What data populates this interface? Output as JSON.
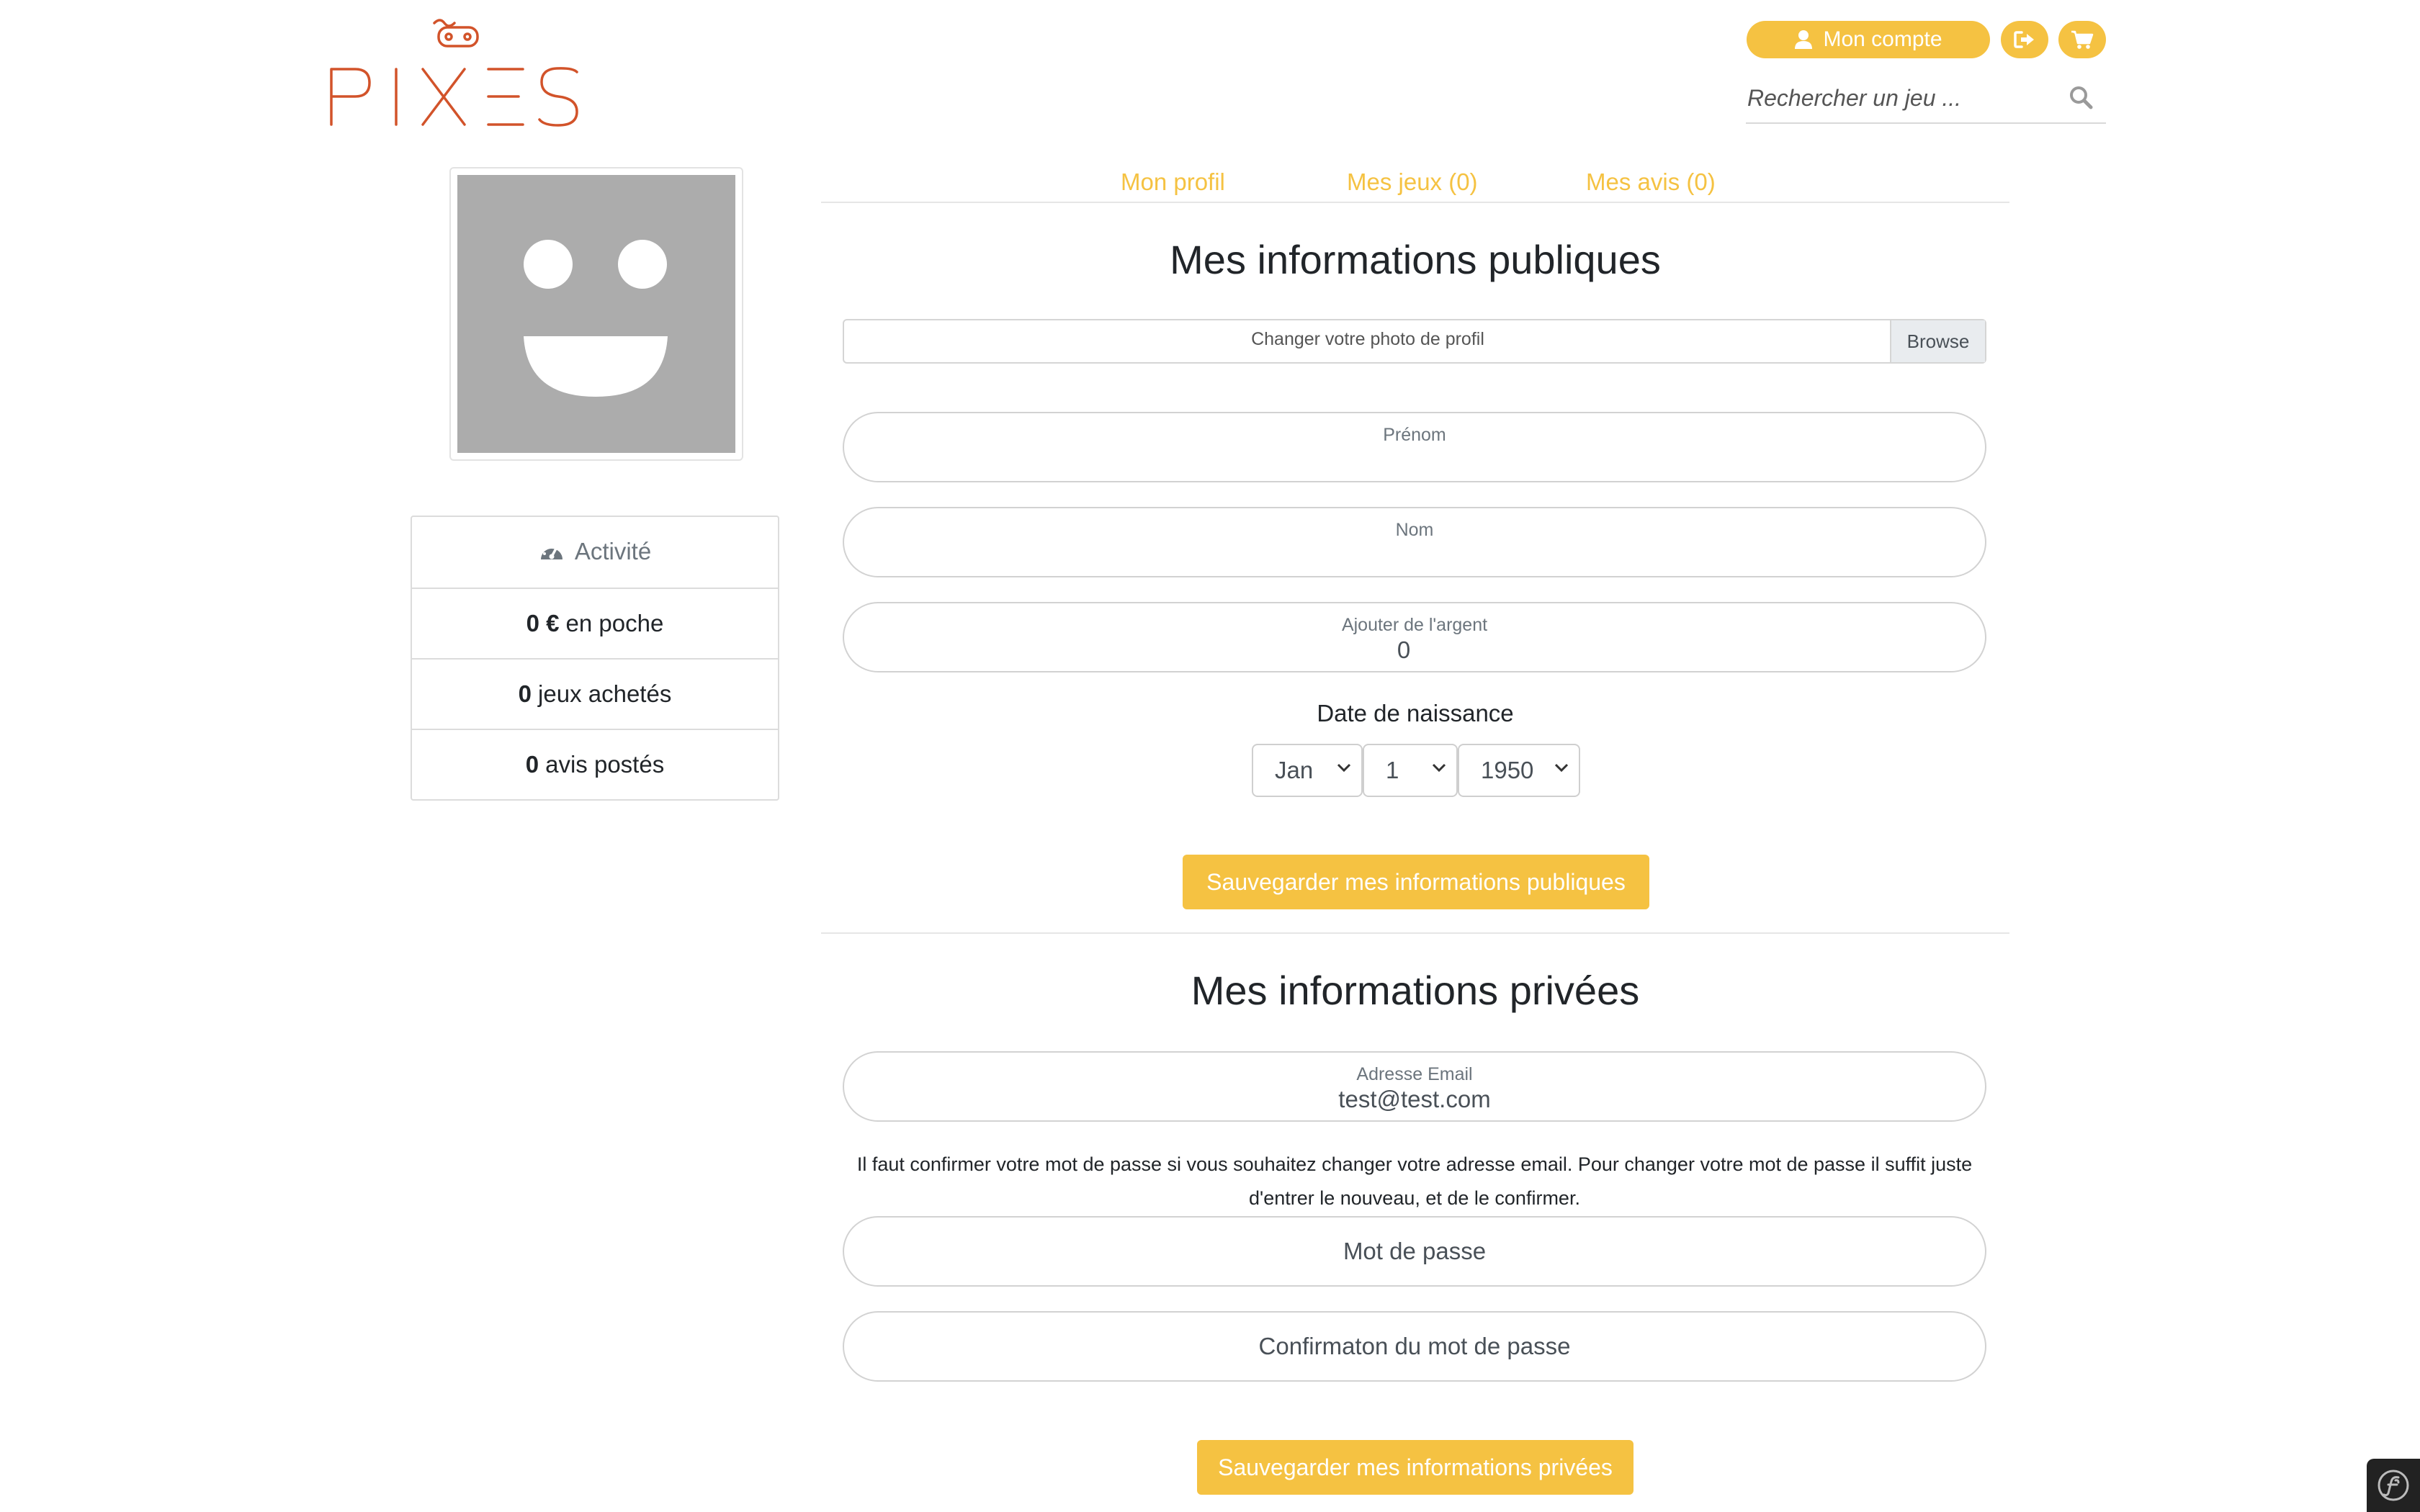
{
  "brand": {
    "logo_text": "PIXES",
    "accent_color": "#f5c242",
    "logo_color": "#d2532a"
  },
  "header": {
    "account_label": "Mon compte",
    "account_icon": "user-icon",
    "logout_icon": "sign-out-icon",
    "cart_icon": "shopping-cart-icon",
    "search_placeholder": "Rechercher un jeu ...",
    "search_icon": "search-icon"
  },
  "sidebar": {
    "avatar_icon": "smiley-avatar-icon",
    "activity": {
      "title": "Activité",
      "title_icon": "tachometer-icon",
      "rows": [
        {
          "value": "0 €",
          "label": "en poche"
        },
        {
          "value": "0",
          "label": "jeux achetés"
        },
        {
          "value": "0",
          "label": "avis postés"
        }
      ]
    }
  },
  "tabs": [
    {
      "label": "Mon profil"
    },
    {
      "label": "Mes jeux (0)"
    },
    {
      "label": "Mes avis (0)"
    }
  ],
  "public_section": {
    "title": "Mes informations publiques",
    "photo_label": "Changer votre photo de profil",
    "browse_label": "Browse",
    "first_name": {
      "label": "Prénom",
      "value": ""
    },
    "last_name": {
      "label": "Nom",
      "value": ""
    },
    "money": {
      "label": "Ajouter de l'argent",
      "value": "0"
    },
    "birth_date": {
      "label": "Date de naissance",
      "month": "Jan",
      "day": "1",
      "year": "1950"
    },
    "save_label": "Sauvegarder mes informations publiques"
  },
  "private_section": {
    "title": "Mes informations privées",
    "email": {
      "label": "Adresse Email",
      "value": "test@test.com"
    },
    "note": "Il faut confirmer votre mot de passe si vous souhaitez changer votre adresse email. Pour changer votre mot de passe il suffit juste d'entrer le nouveau, et de le confirmer.",
    "password_placeholder": "Mot de passe",
    "password_confirm_placeholder": "Confirmaton du mot de passe",
    "save_label": "Sauvegarder mes informations privées"
  },
  "debug_toolbar_icon": "symfony-icon"
}
